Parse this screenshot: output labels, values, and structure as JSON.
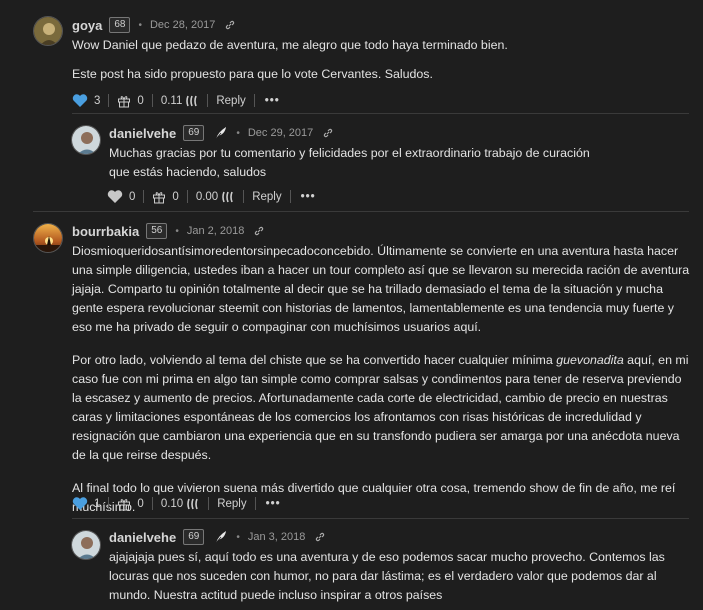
{
  "comments": [
    {
      "author": "goya",
      "rep": "68",
      "date": "Dec 28, 2017",
      "paragraphs": [
        "Wow Daniel que pedazo de aventura, me alegro que todo haya terminado bien.",
        "Este post ha sido propuesto para que lo vote Cervantes. Saludos."
      ],
      "votes": "3",
      "tips": "0",
      "payout": "0.11",
      "reply_label": "Reply",
      "more_label": "•••"
    },
    {
      "author": "danielvehe",
      "rep": "69",
      "date": "Dec 29, 2017",
      "paragraphs": [
        "Muchas gracias por tu comentario y felicidades por el extraordinario trabajo de curación que estás haciendo, saludos"
      ],
      "votes": "0",
      "tips": "0",
      "payout": "0.00",
      "reply_label": "Reply",
      "more_label": "•••"
    },
    {
      "author": "bourrbakia",
      "rep": "56",
      "date": "Jan 2, 2018",
      "paragraphs": [
        "Diosmioqueridosantísimoredentorsinpecadoconcebido. Últimamente se convierte en una aventura hasta hacer una simple diligencia, ustedes iban a hacer un tour completo así que se llevaron su merecida ración de aventura jajaja. Comparto tu opinión totalmente al decir que se ha trillado demasiado el tema de la situación y mucha gente espera revolucionar steemit con historias de lamentos, lamentablemente es una tendencia muy fuerte y eso me ha privado de seguir o compaginar con muchísimos usuarios aquí.",
        "Al final todo lo que vivieron suena más divertido que cualquier otra cosa, tremendo show de fin de año, me reí muchísimo."
      ],
      "p2_before": "Por otro lado, volviendo al tema del chiste que se ha convertido hacer cualquier mínima ",
      "p2_em": "guevonadita",
      "p2_after": " aquí, en mi caso fue con mi prima en algo tan simple como comprar salsas y condimentos para tener de reserva previendo la escasez y aumento de precios. Afortunadamente cada corte de electricidad, cambio de precio en nuestras caras y limitaciones espontáneas de los comercios los afrontamos con risas históricas de incredulidad y resignación que cambiaron una experiencia que en su transfondo pudiera ser amarga por una anécdota nueva de la que reirse después.",
      "votes": "1",
      "tips": "0",
      "payout": "0.10",
      "reply_label": "Reply",
      "more_label": "•••"
    },
    {
      "author": "danielvehe",
      "rep": "69",
      "date": "Jan 3, 2018",
      "paragraphs": [
        "ajajajaja pues sí, aquí todo es una aventura y de eso podemos sacar mucho provecho. Contemos las locuras que nos suceden con humor, no para dar lástima; es el verdadero valor que podemos dar al mundo. Nuestra actitud puede incluso inspirar a otros países"
      ]
    }
  ],
  "colors": {
    "background": "#1e1e1e",
    "heart_active": "#4a9fe0",
    "heart_inactive": "#c8c8c8"
  },
  "icons": [
    "heart-icon",
    "gift-icon",
    "steem-power-icon",
    "link-icon",
    "feather-icon"
  ]
}
